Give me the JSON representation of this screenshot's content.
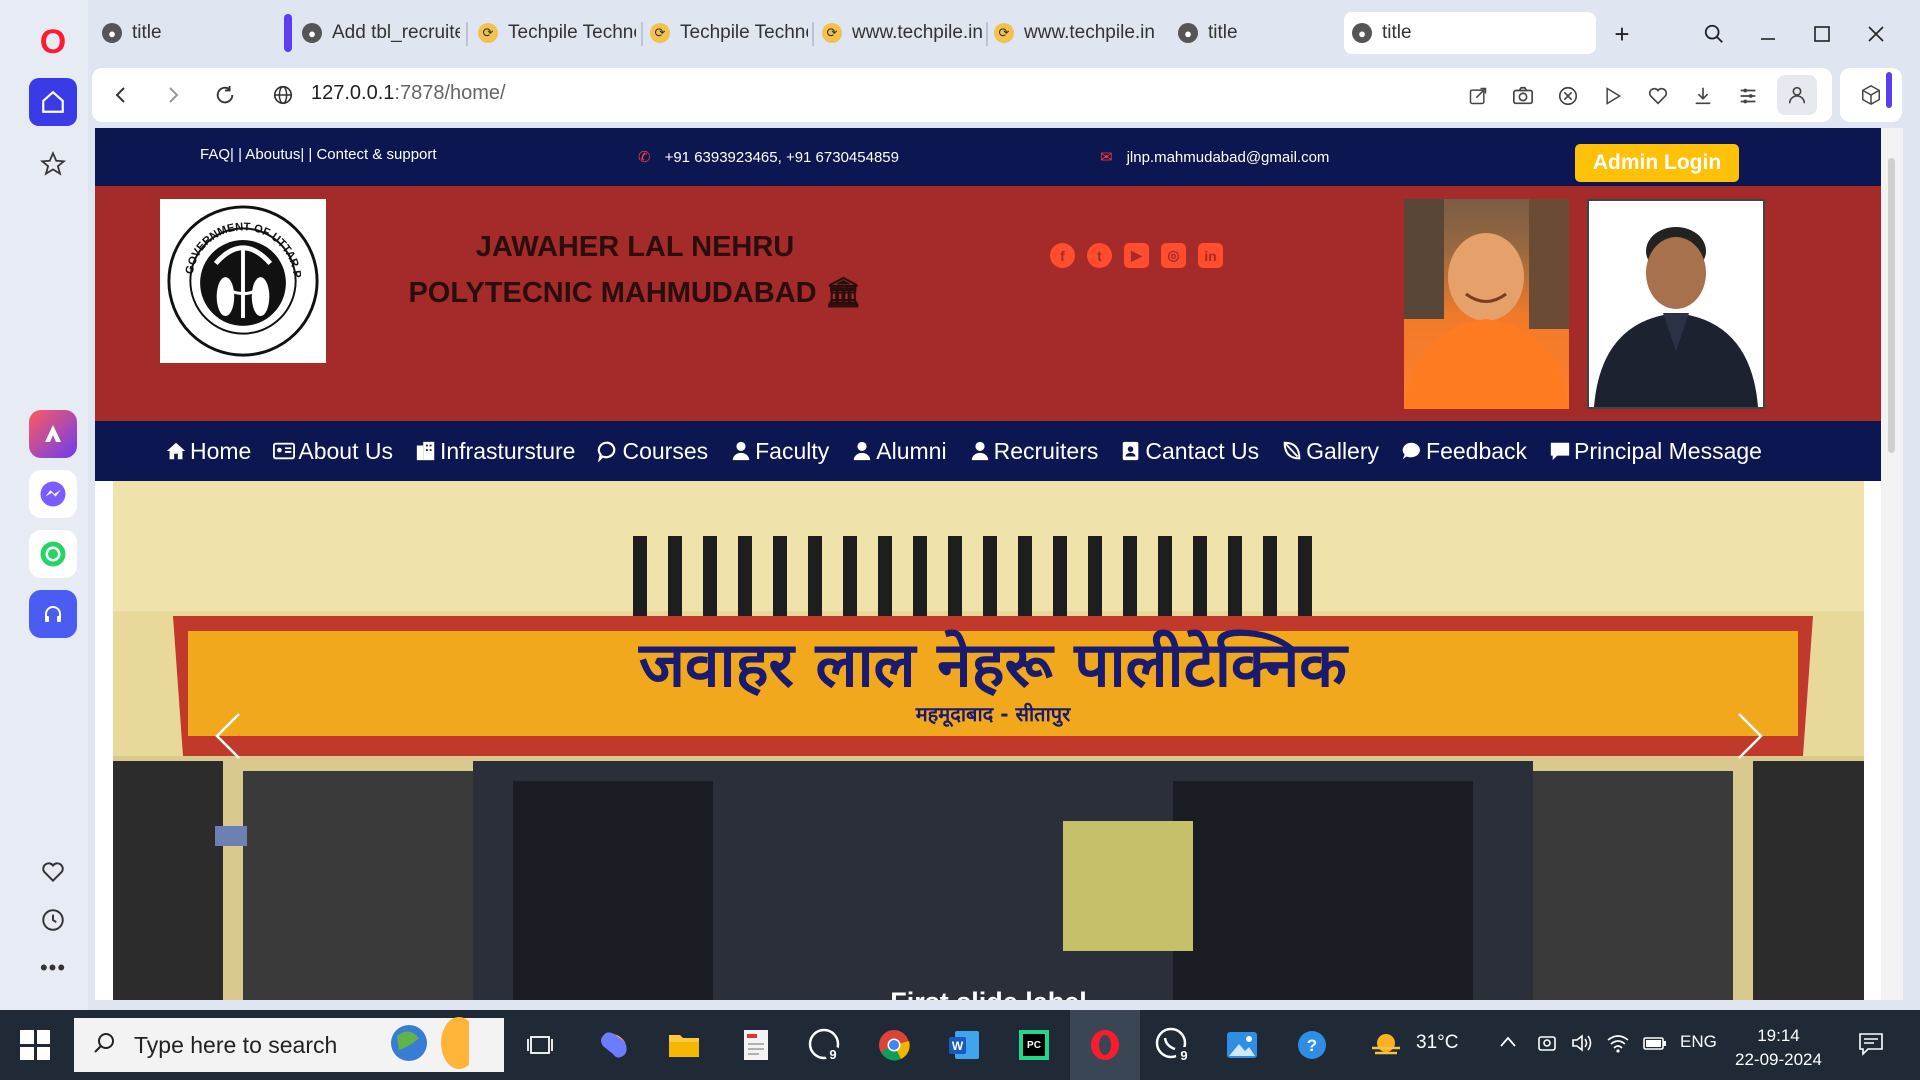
{
  "browser": {
    "tabs": [
      {
        "title": "title",
        "favicon": "globe-icon"
      },
      {
        "title": "Add tbl_recruite",
        "favicon": "globe-icon"
      },
      {
        "title": "Techpile Techno",
        "favicon": "techpile-icon"
      },
      {
        "title": "Techpile Techno",
        "favicon": "techpile-icon"
      },
      {
        "title": "www.techpile.in",
        "favicon": "techpile-icon"
      },
      {
        "title": "www.techpile.in",
        "favicon": "techpile-icon"
      },
      {
        "title": "title",
        "favicon": "globe-icon"
      },
      {
        "title": "title",
        "favicon": "globe-icon",
        "active": true
      }
    ],
    "url_host": "127.0.0.1",
    "url_path": ":7878/home/"
  },
  "site": {
    "top_links": "FAQ| | Aboutus| | Contect & support",
    "phone": "+91 6393923465, +91 6730454859",
    "email": "jlnp.mahmudabad@gmail.com",
    "admin_login": "Admin Login",
    "college_line1": "JAWAHER LAL NEHRU",
    "college_line2": "POLYTECNIC MAHMUDABAD",
    "logo_text": "GOVERNMENT OF UTTAR PRADESH",
    "nav": [
      {
        "label": "Home",
        "icon": "home-icon"
      },
      {
        "label": "About Us",
        "icon": "id-card-icon"
      },
      {
        "label": "Infrastursture",
        "icon": "building-icon"
      },
      {
        "label": "Courses",
        "icon": "chat-icon"
      },
      {
        "label": "Faculty",
        "icon": "user-icon"
      },
      {
        "label": "Alumni",
        "icon": "user-icon"
      },
      {
        "label": "Recruiters",
        "icon": "user-icon"
      },
      {
        "label": "Cantact Us",
        "icon": "contact-icon"
      },
      {
        "label": "Gallery",
        "icon": "leaf-icon"
      },
      {
        "label": "Feedback",
        "icon": "comment-icon"
      },
      {
        "label": "Principal Message",
        "icon": "message-icon"
      }
    ],
    "slide_sign": "जवाहर लाल नेहरू पालीटेक्निक",
    "slide_subsign": "महमूदाबाद - सीतापुर",
    "slide_caption": "First slide label"
  },
  "taskbar": {
    "search_placeholder": "Type here to search",
    "temperature": "31°C",
    "language": "ENG",
    "time": "19:14",
    "date": "22-09-2024",
    "whatsapp_badge": "9",
    "chrome_badge": "9"
  },
  "colors": {
    "top_strip": "#0c1650",
    "header": "#a52a2a",
    "admin_button": "#ffc107"
  }
}
